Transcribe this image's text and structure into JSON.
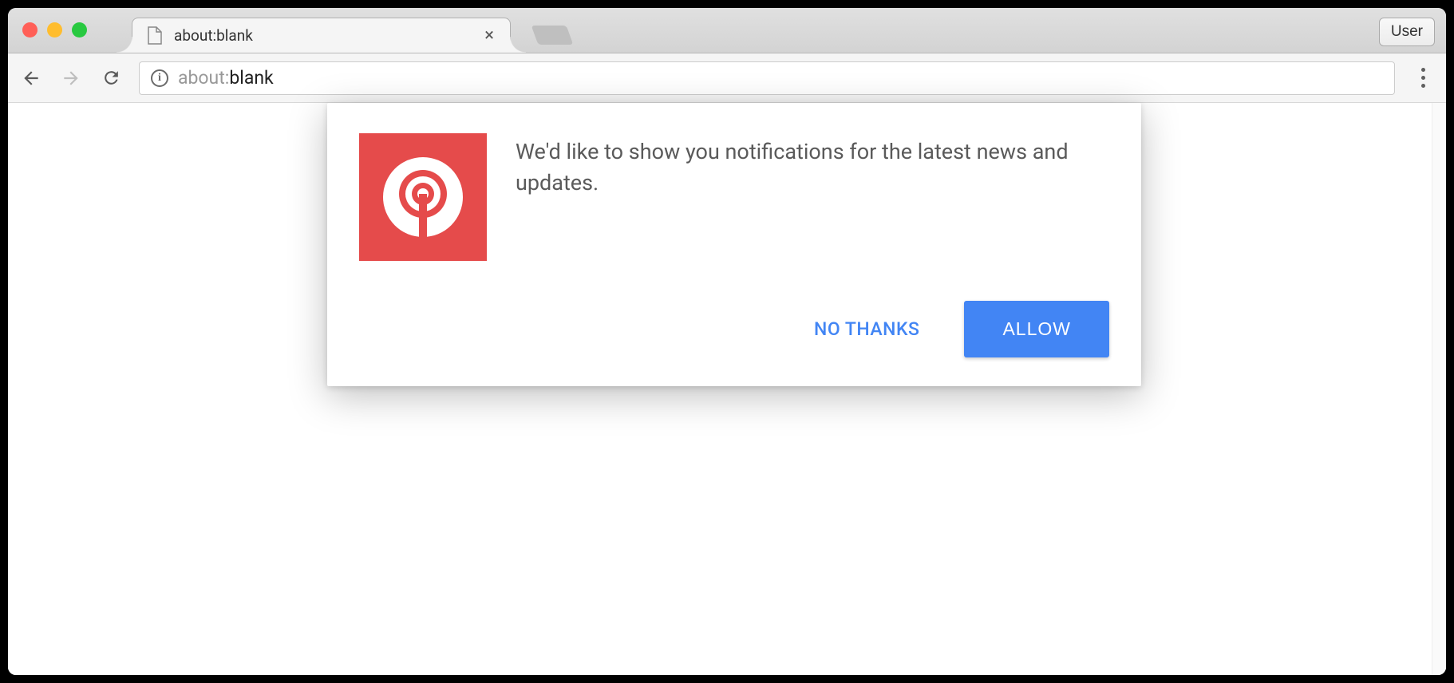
{
  "window": {
    "user_button": "User"
  },
  "tab": {
    "title": "about:blank"
  },
  "address": {
    "scheme": "about:",
    "path": "blank"
  },
  "dialog": {
    "message": "We'd like to show you notifications for the latest news and updates.",
    "deny_label": "NO THANKS",
    "allow_label": "ALLOW",
    "icon_name": "onesignal-icon",
    "accent_color": "#e54b4b",
    "primary_color": "#4285f4"
  }
}
